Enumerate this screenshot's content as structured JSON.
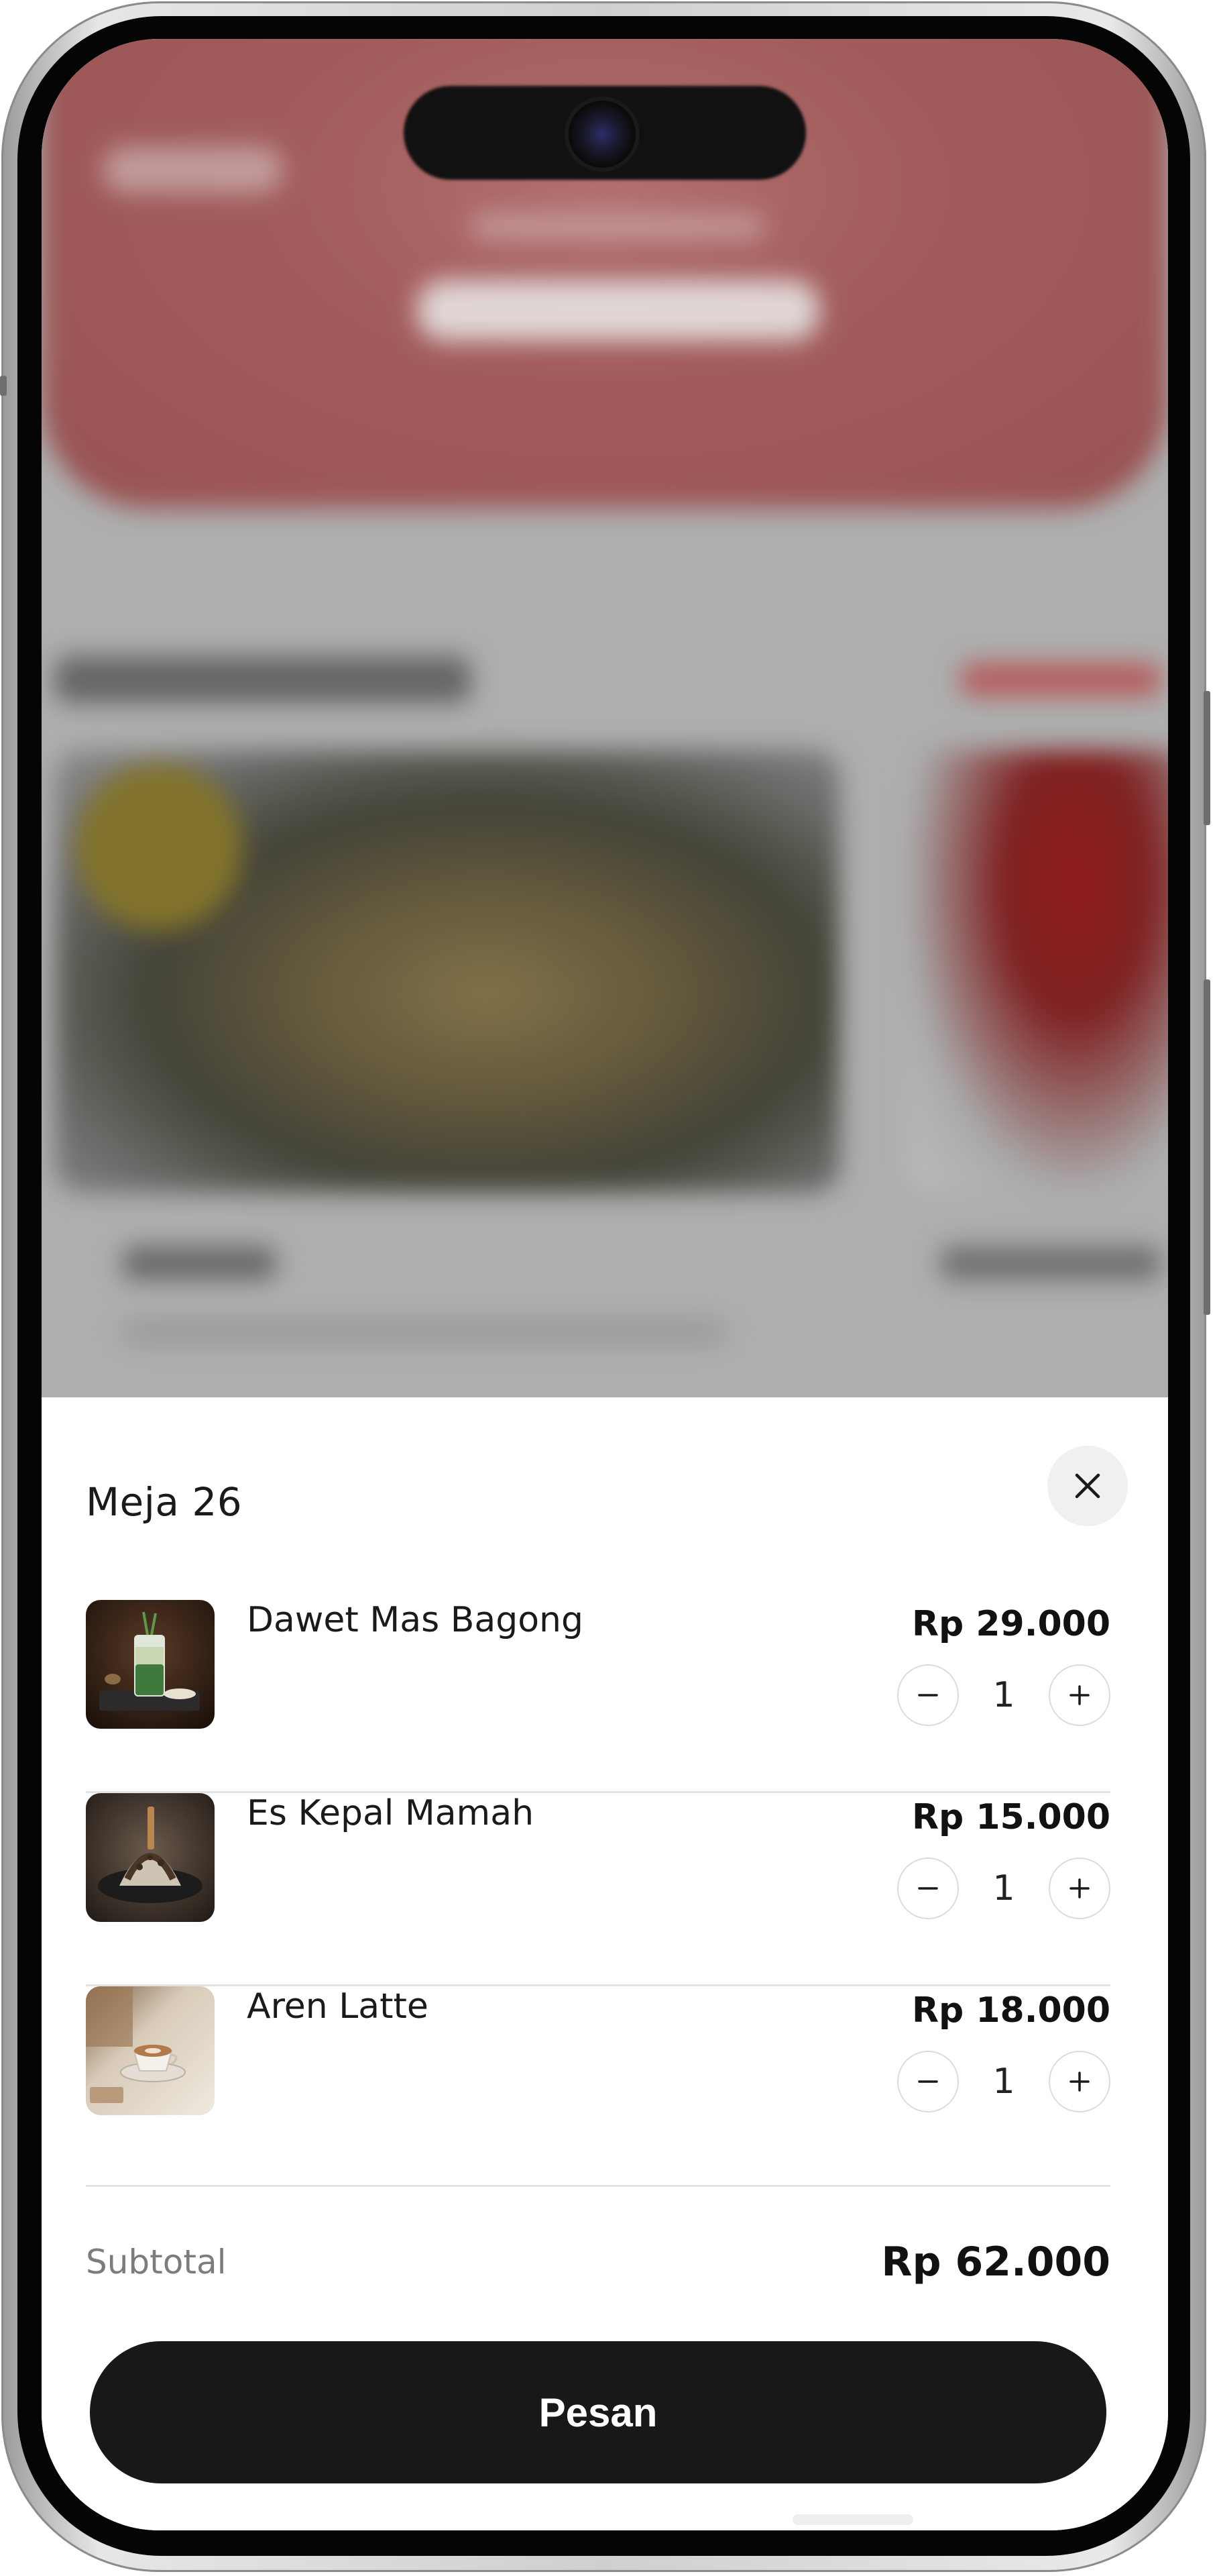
{
  "sheet": {
    "title": "Meja 26",
    "close_icon": "close-icon"
  },
  "cart": {
    "items": [
      {
        "name": "Dawet Mas Bagong",
        "price": "Rp 29.000",
        "quantity": "1",
        "thumb": "iced-drink-glass"
      },
      {
        "name": "Es Kepal Mamah",
        "price": "Rp 15.000",
        "quantity": "1",
        "thumb": "shaved-ice-dessert"
      },
      {
        "name": "Aren Latte",
        "price": "Rp 18.000",
        "quantity": "1",
        "thumb": "latte-cup"
      }
    ],
    "minus_icon": "minus-icon",
    "plus_icon": "plus-icon"
  },
  "summary": {
    "subtotal_label": "Subtotal",
    "subtotal_value": "Rp 62.000"
  },
  "actions": {
    "order_label": "Pesan"
  },
  "colors": {
    "primary_button": "#181818",
    "header_red": "#b06464",
    "muted_text": "#7c7c7c",
    "divider": "#e3e3e3"
  }
}
